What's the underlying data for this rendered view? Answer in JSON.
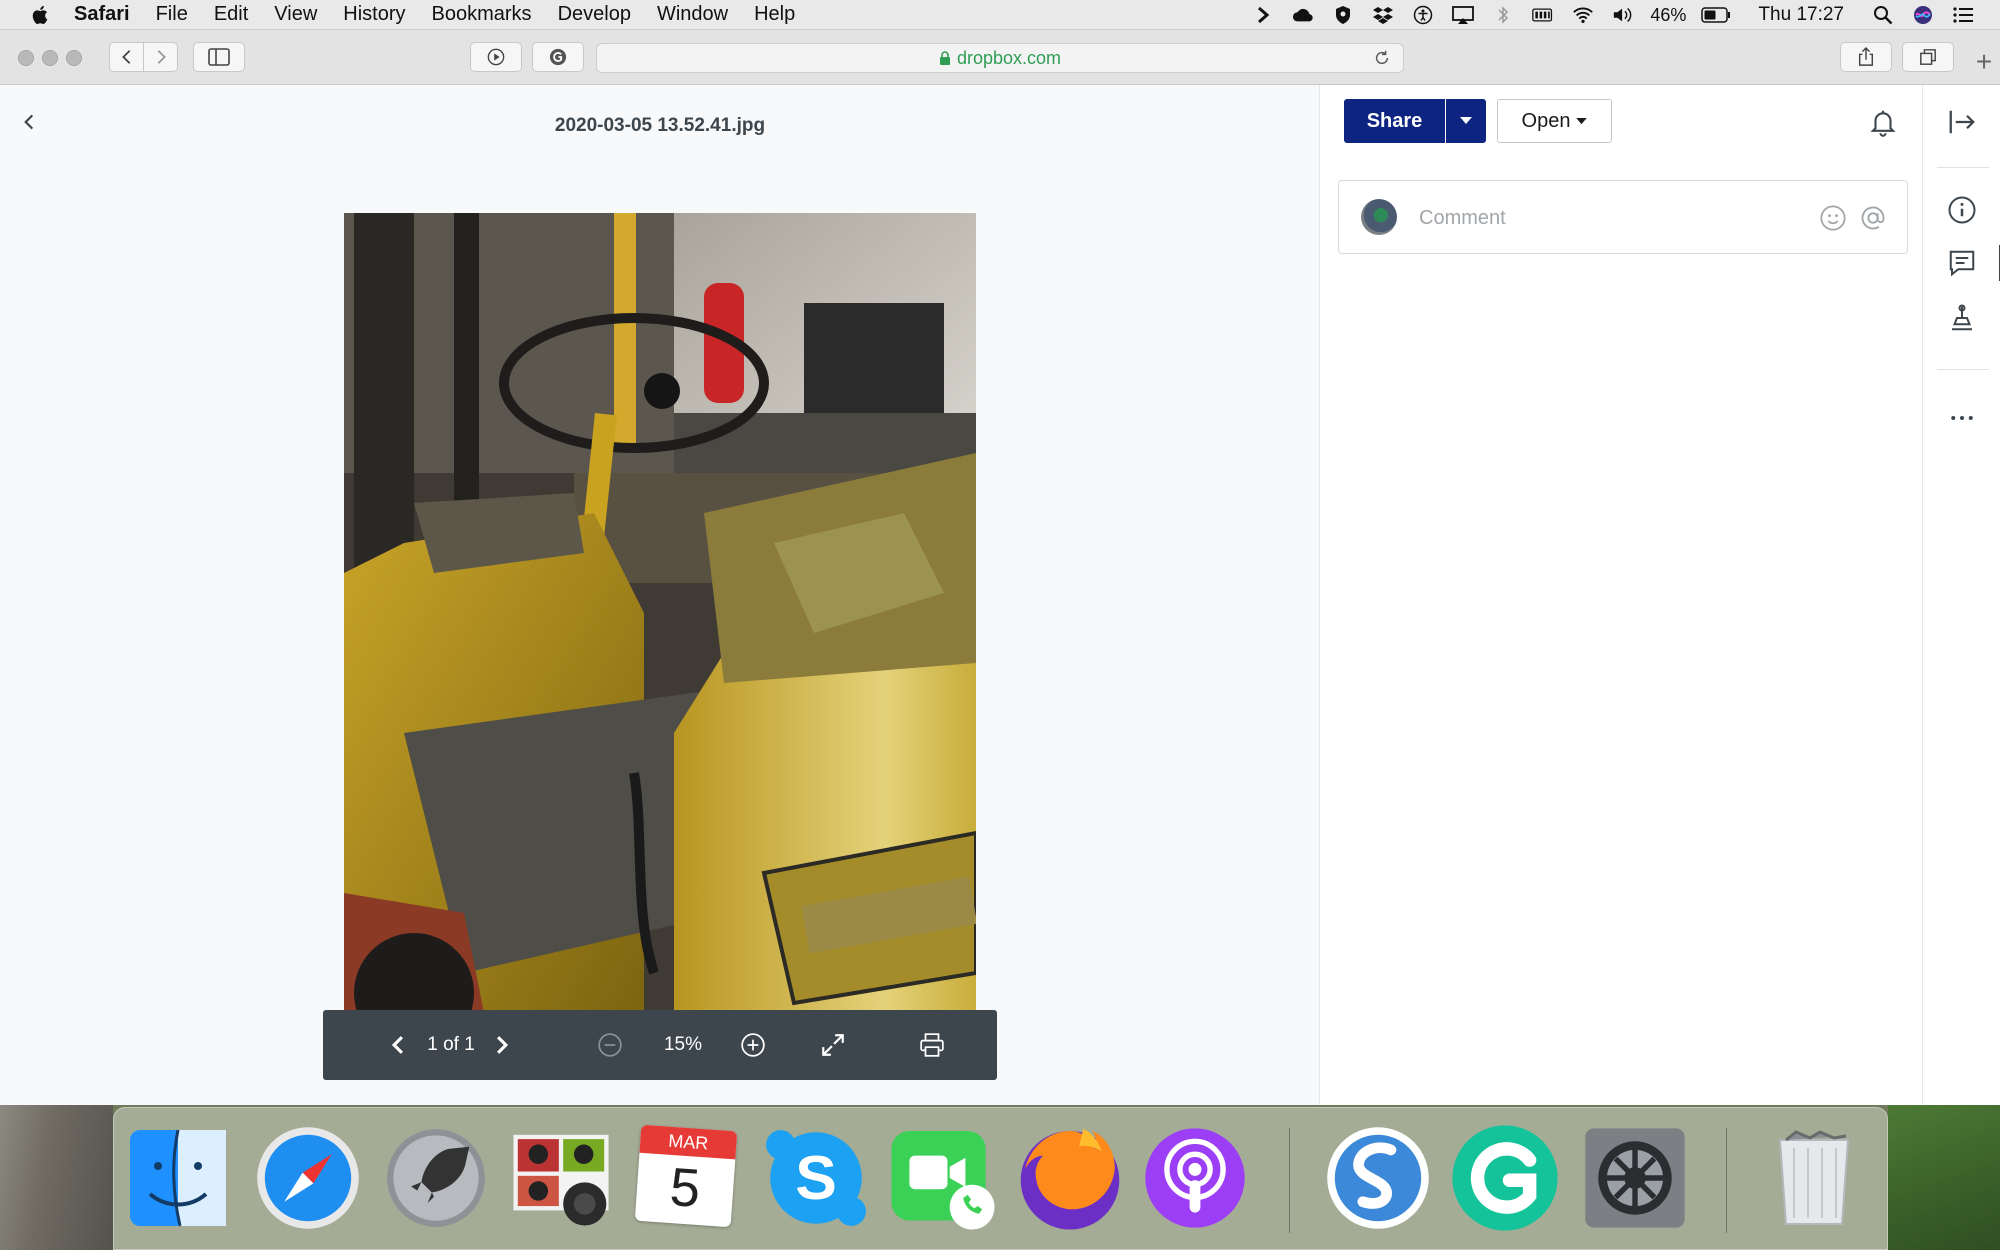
{
  "menubar": {
    "items": [
      "Safari",
      "File",
      "Edit",
      "View",
      "History",
      "Bookmarks",
      "Develop",
      "Window",
      "Help"
    ],
    "battery_percent": "46%",
    "clock": "Thu 17:27",
    "status_icons": [
      "chevron-right-icon",
      "creative-cloud-icon",
      "shield-icon",
      "dropbox-icon",
      "accessibility-icon",
      "airplay-icon",
      "bluetooth-icon",
      "battery-level-icon",
      "wifi-icon",
      "volume-icon",
      "battery-icon",
      "spotlight-icon",
      "siri-icon",
      "notification-center-icon"
    ]
  },
  "toolbar": {
    "url": "dropbox.com",
    "new_tab": "+"
  },
  "viewer": {
    "filename": "2020-03-05 13.52.41.jpg",
    "page_indicator": "1 of 1",
    "zoom": "15%"
  },
  "sidebar": {
    "share_label": "Share",
    "open_label": "Open",
    "comment_placeholder": "Comment"
  },
  "dock": {
    "apps": [
      "Finder",
      "Safari",
      "Launchpad",
      "Photo Booth",
      "Calendar",
      "Skype",
      "FaceTime",
      "Firefox",
      "Podcasts",
      "Simplenote",
      "Grammarly",
      "System Preferences",
      "Trash"
    ],
    "calendar_month": "MAR",
    "calendar_day": "5"
  }
}
